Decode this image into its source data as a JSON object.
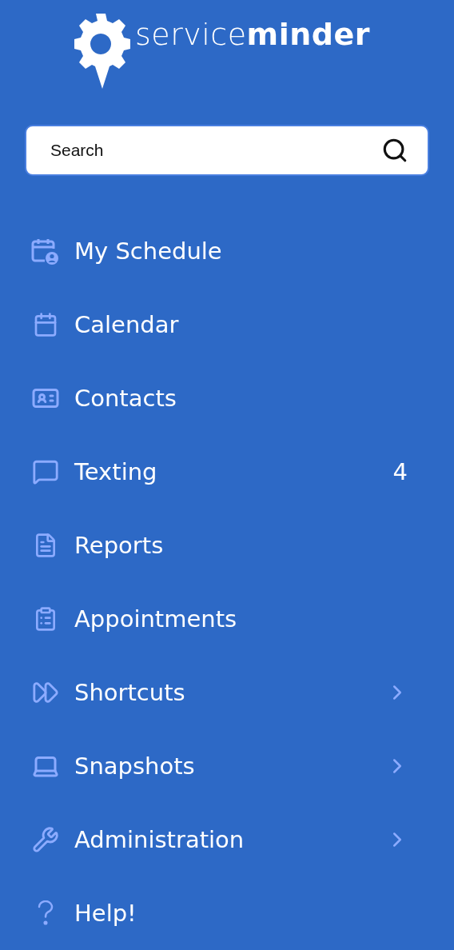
{
  "logo": {
    "text": "service**minder**"
  },
  "search": {
    "placeholder": "Search"
  },
  "menu": [
    {
      "label": "My Schedule",
      "kind": "link"
    },
    {
      "label": "Calendar",
      "kind": "link"
    },
    {
      "label": "Contacts",
      "kind": "link"
    },
    {
      "label": "Texting",
      "kind": "badge",
      "badge": "4"
    },
    {
      "label": "Reports",
      "kind": "link"
    },
    {
      "label": "Appointments",
      "kind": "link"
    },
    {
      "label": "Shortcuts",
      "kind": "submenu"
    },
    {
      "label": "Snapshots",
      "kind": "submenu"
    },
    {
      "label": "Administration",
      "kind": "submenu"
    },
    {
      "label": "Help!",
      "kind": "link"
    }
  ]
}
